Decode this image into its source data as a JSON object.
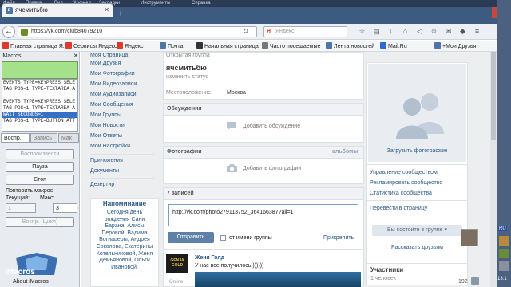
{
  "menubar": [
    "Файл",
    "Правка",
    "Вид",
    "Журнал",
    "Закладки",
    "Инструменты",
    "Справка"
  ],
  "tab": {
    "title": "ячсмитьбю"
  },
  "url": "https://vk.com/club84079210",
  "search_placeholder": "Яндекс",
  "bookmarks": [
    {
      "label": "Главная страница Я...",
      "color": "#e03a2f"
    },
    {
      "label": "Сервисы Яндекса",
      "color": "#e03a2f"
    },
    {
      "label": "Яндекс",
      "color": "#e03a2f"
    },
    {
      "label": "Почта",
      "color": "#4a76a8"
    },
    {
      "label": "Начальная страница",
      "color": "#333333"
    },
    {
      "label": "Часто посещаемые",
      "color": "#777777"
    },
    {
      "label": "Лента новостей",
      "color": "#4a76a8"
    },
    {
      "label": "Mail.Ru",
      "color": "#2a6bd6"
    },
    {
      "label": "+Мои Друзья",
      "color": "#4a76a8"
    }
  ],
  "imacros": {
    "title": "iMacros",
    "close": "✕",
    "log": [
      "EVENTS TYPE=KEYPRESS SELE",
      "TAG POS=1 TYPE=TEXTAREA A",
      "",
      "EVENTS TYPE=KEYPRESS SELE",
      "TAG POS=1 TYPE=TEXTAREA A",
      "WAIT SECONDS=1",
      "TAG POS=1 TYPE=BUTTON ATT"
    ],
    "tabs": [
      "Воспр.",
      "Запись",
      "Мак"
    ],
    "btn_replay": "Воспроизвести",
    "btn_pause": "Пауза",
    "btn_stop": "Стоп",
    "repeat_label": "Повторить макрос",
    "current_label": "Текущий:",
    "max_label": "Макс:",
    "current_value": "1",
    "max_value": "3",
    "btn_loop": "Воспр. (Цикл)",
    "logo_text": "iMacros",
    "about": "About iMacros"
  },
  "left_menu": [
    "Моя Страница",
    "Мои Друзья",
    "Мои Фотографии",
    "Мои Видеозаписи",
    "Мои Аудиозаписи",
    "Мои Сообщения",
    "Мои Группы",
    "Мои Новости",
    "Мои Ответы",
    "Мои Настройки",
    "Приложения",
    "Документы",
    "Дезертир"
  ],
  "reminder": {
    "title": "Напоминание",
    "text": "Сегодня день рождения Сани Барана, Алисы Перовой, Вадима Богнацеры, Андрея Соколова, Екатерины Котельниковой, Женя Демьяновой, Ольги Ивановой."
  },
  "group": {
    "header_cut": "Открытая группа",
    "name": "ячсмитьбю",
    "change_status": "изменить статус",
    "location_label": "Местоположение:",
    "location_value": "Москва",
    "discussions_header": "Обсуждения",
    "add_discussion": "Добавить обсуждение",
    "photos_header": "Фотографии",
    "photos_albums": "альбомы",
    "add_photos": "Добавить фотографии",
    "posts_header": "7 записей",
    "post_text": "http://vk.com/photo279113752_364166387?all=1",
    "send": "Отправить",
    "from_group": "от имени группы",
    "attach": "Прикрепить",
    "post_author": "Женя Голд",
    "post_body": "У нас все получилось ))))))",
    "post_thumb_text": "GENJA GOLD",
    "online": "Online"
  },
  "right": {
    "upload_photo": "Загрузить фотографию",
    "links": [
      "Управление сообществом",
      "Рекламировать сообщество",
      "Статистика сообщества"
    ],
    "move_to_page": "Перевести в страницу",
    "in_group": "Вы состоите в группе ▾",
    "tell_friends": "Рассказать друзьям",
    "members_header": "Участники",
    "members_count": "1 человек",
    "badge_count": "192"
  },
  "taskbar": {
    "lang": "RU",
    "time": "13:1"
  }
}
